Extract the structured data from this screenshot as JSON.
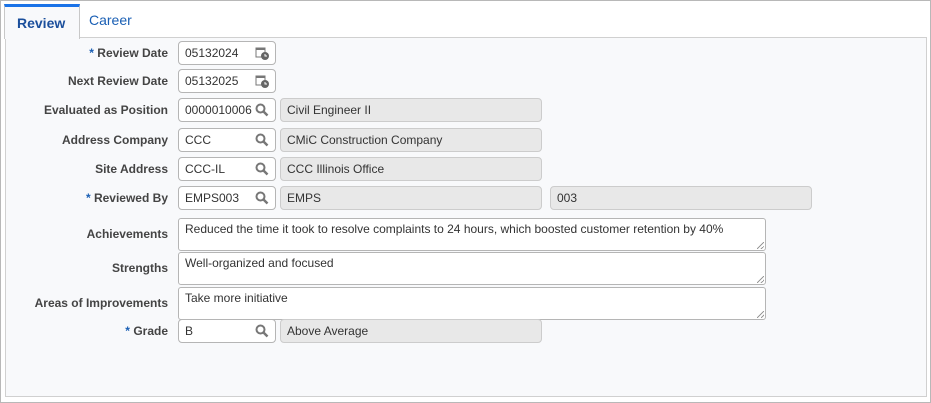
{
  "tabs": [
    {
      "label": "Review",
      "active": true
    },
    {
      "label": "Career",
      "active": false
    }
  ],
  "form": {
    "review_date": {
      "label": "Review Date",
      "required": true,
      "value": "05132024"
    },
    "next_review_date": {
      "label": "Next Review Date",
      "value": "05132025"
    },
    "evaluated_position": {
      "label": "Evaluated as Position",
      "value": "0000010006",
      "description": "Civil Engineer II"
    },
    "address_company": {
      "label": "Address Company",
      "value": "CCC",
      "description": "CMiC Construction Company"
    },
    "site_address": {
      "label": "Site Address",
      "value": "CCC-IL",
      "description": "CCC Illinois Office"
    },
    "reviewed_by": {
      "label": "Reviewed By",
      "required": true,
      "value": "EMPS003",
      "description": "EMPS",
      "description2": "003"
    },
    "achievements": {
      "label": "Achievements",
      "value": "Reduced the time it took to resolve complaints to 24 hours, which boosted customer retention by 40%"
    },
    "strengths": {
      "label": "Strengths",
      "value": "Well-organized and focused"
    },
    "improvements": {
      "label": "Areas of Improvements",
      "value": "Take more initiative"
    },
    "grade": {
      "label": "Grade",
      "required": true,
      "value": "B",
      "description": "Above Average"
    }
  },
  "required_marker": "* ",
  "colors": {
    "accent": "#1a73e8",
    "tab_text": "#1b4f9c"
  }
}
